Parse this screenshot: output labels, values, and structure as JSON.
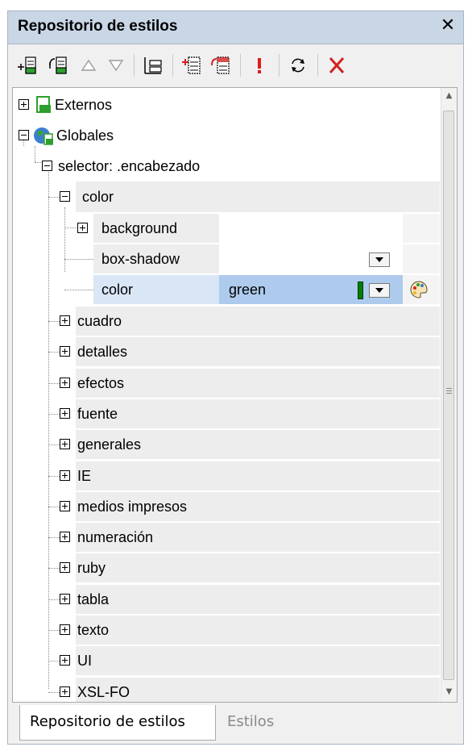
{
  "window": {
    "title": "Repositorio de estilos",
    "close_glyph": "✕"
  },
  "toolbar": {
    "buttons": [
      {
        "name": "add-stylesheet-icon",
        "color": "#2e9e2e"
      },
      {
        "name": "insert-stylesheet-icon",
        "color": "#2e9e2e"
      },
      {
        "name": "move-up-icon"
      },
      {
        "name": "move-down-icon"
      },
      {
        "name": "collapse-tree-icon"
      },
      {
        "name": "append-rule-icon",
        "color": "#d42020"
      },
      {
        "name": "insert-rule-icon",
        "color": "#d42020"
      },
      {
        "name": "important-icon",
        "color": "#e01a1a"
      },
      {
        "name": "reload-icon"
      },
      {
        "name": "delete-icon",
        "color": "#d42020"
      }
    ]
  },
  "tree": {
    "externos": "Externos",
    "globales": "Globales",
    "selector": "selector: .encabezado",
    "color_group": "color",
    "properties": [
      {
        "label": "background",
        "value": ""
      },
      {
        "label": "box-shadow",
        "value": ""
      },
      {
        "label": "color",
        "value": "green",
        "selected": true
      }
    ],
    "selected_color_swatch": "#008000",
    "groups": [
      "cuadro",
      "detalles",
      "efectos",
      "fuente",
      "generales",
      "IE",
      "medios impresos",
      "numeración",
      "ruby",
      "tabla",
      "texto",
      "UI",
      "XSL-FO"
    ]
  },
  "tabs": [
    {
      "label": "Repositorio de estilos",
      "active": true
    },
    {
      "label": "Estilos",
      "active": false
    }
  ],
  "colors": {
    "titlebar": "#c8d6e6",
    "selection": "#aecbee",
    "selection_light": "#d9e6f5",
    "group_bg": "#ededed"
  }
}
